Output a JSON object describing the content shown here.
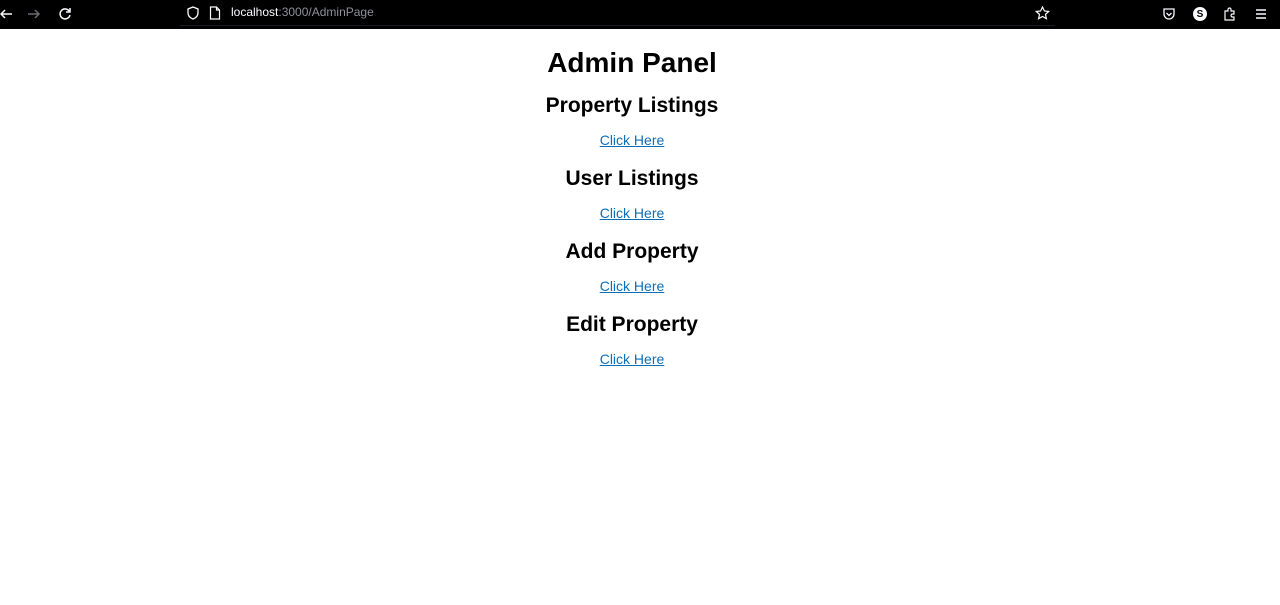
{
  "browser": {
    "url_host": "localhost",
    "url_path": ":3000/AdminPage",
    "account_initial": "S"
  },
  "page": {
    "title": "Admin Panel",
    "sections": [
      {
        "heading": "Property Listings",
        "link": "Click Here"
      },
      {
        "heading": "User Listings",
        "link": "Click Here"
      },
      {
        "heading": "Add Property",
        "link": "Click Here"
      },
      {
        "heading": "Edit Property",
        "link": "Click Here"
      }
    ]
  },
  "colors": {
    "link": "#0b6fba",
    "chrome_background": "#000000"
  }
}
